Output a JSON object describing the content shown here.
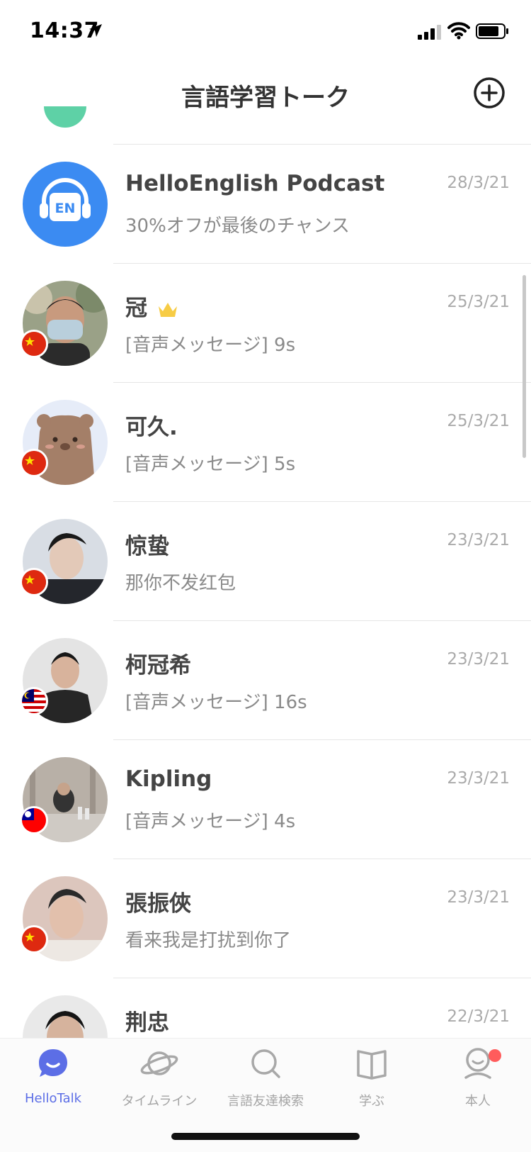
{
  "status_bar": {
    "time": "14:37"
  },
  "header": {
    "title": "言語学習トーク"
  },
  "chats": [
    {
      "name": "HelloEnglish Podcast",
      "preview": "30%オフが最後のチャンス",
      "date": "28/3/21",
      "avatar_text": "EN"
    },
    {
      "name": "冠",
      "preview": "[音声メッセージ] 9s",
      "date": "25/3/21"
    },
    {
      "name": "可久.",
      "preview": "[音声メッセージ] 5s",
      "date": "25/3/21"
    },
    {
      "name": "惊蛰",
      "preview": "那你不发红包",
      "date": "23/3/21"
    },
    {
      "name": "柯冠希",
      "preview": "[音声メッセージ] 16s",
      "date": "23/3/21"
    },
    {
      "name": "Kipling",
      "preview": "[音声メッセージ] 4s",
      "date": "23/3/21"
    },
    {
      "name": "張振俠",
      "preview": "看来我是打扰到你了",
      "date": "23/3/21"
    },
    {
      "name": "荆忠",
      "preview": "",
      "date": "22/3/21"
    }
  ],
  "tabs": [
    {
      "label": "HelloTalk",
      "icon": "chat-bubble-icon"
    },
    {
      "label": "タイムライン",
      "icon": "planet-icon"
    },
    {
      "label": "言語友達検索",
      "icon": "search-icon"
    },
    {
      "label": "学ぶ",
      "icon": "book-icon"
    },
    {
      "label": "本人",
      "icon": "profile-icon"
    }
  ],
  "colors": {
    "accent": "#5c6ee6",
    "podcast_blue": "#3b8bf2",
    "notification": "#ff5c5c"
  }
}
